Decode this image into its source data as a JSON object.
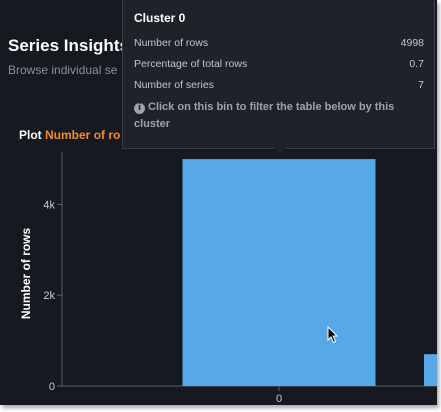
{
  "page": {
    "title": "Series Insights",
    "subtitle": "Browse individual se"
  },
  "plot": {
    "label": "Plot",
    "selected_metric": "Number of ro"
  },
  "tooltip": {
    "title": "Cluster 0",
    "rows": [
      {
        "label": "Number of rows",
        "value": "4998"
      },
      {
        "label": "Percentage of total rows",
        "value": "0.7"
      },
      {
        "label": "Number of series",
        "value": "7"
      }
    ],
    "hint": "Click on this bin to filter the table below by this cluster",
    "hint_icon": "info-icon"
  },
  "colors": {
    "background": "#16191f",
    "bar": "#56a8e6",
    "accent": "#f28c28",
    "tooltip_bg": "#1f2228"
  },
  "chart_data": {
    "type": "bar",
    "categories": [
      "0",
      ""
    ],
    "values": [
      4998,
      700
    ],
    "ylabel": "Number of rows",
    "xlabel": "",
    "ylim": [
      0,
      5000
    ],
    "yticks": [
      "0",
      "2k",
      "4k"
    ],
    "ytick_values": [
      0,
      2000,
      4000
    ],
    "grid": false,
    "legend": "none"
  }
}
